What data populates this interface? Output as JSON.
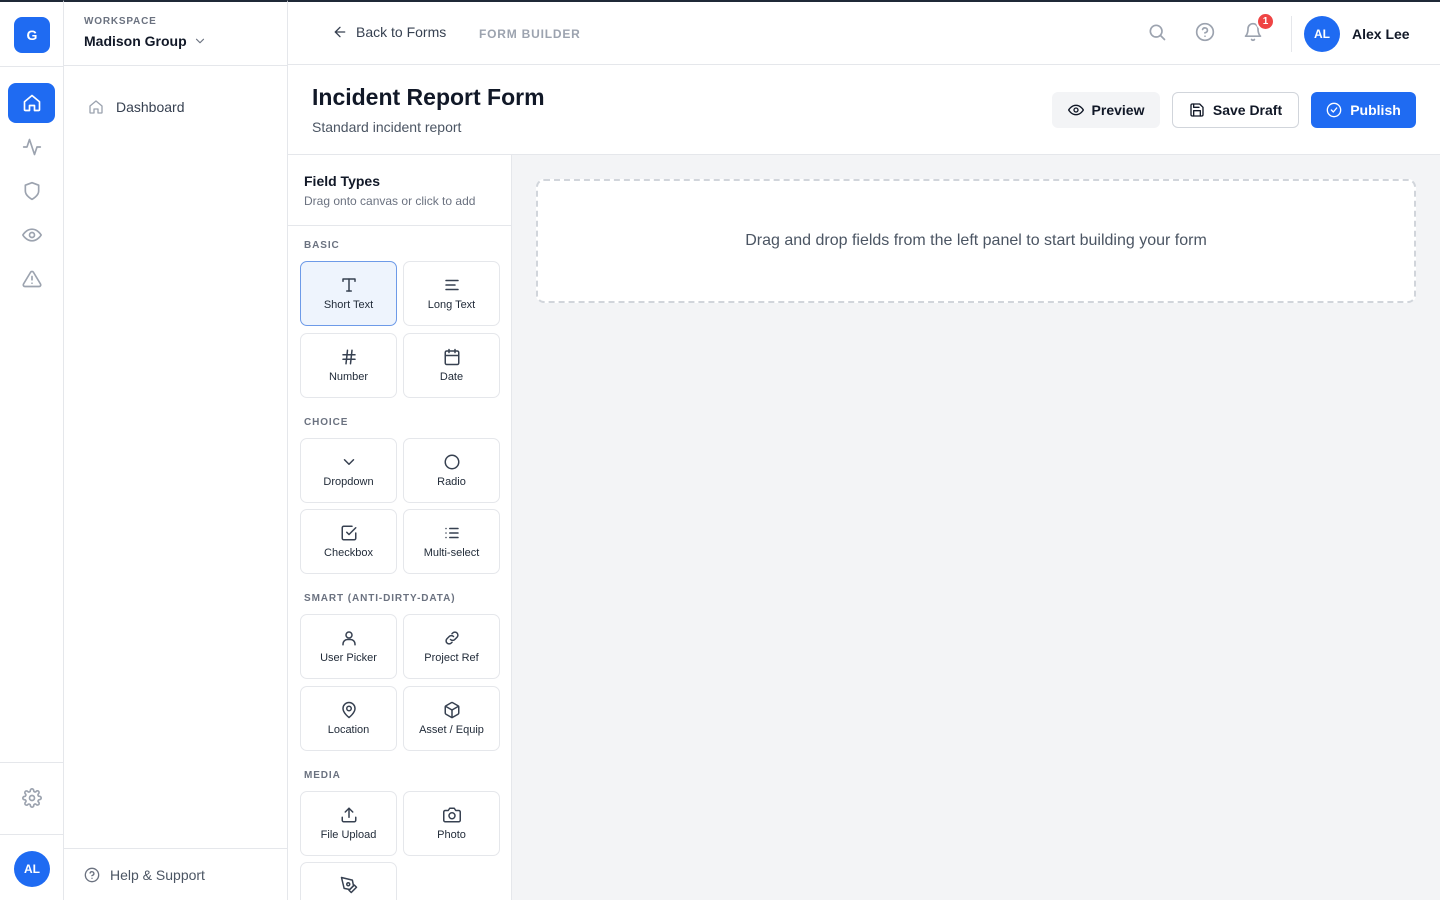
{
  "rail": {
    "logo": "G",
    "nav": [
      "Home",
      "Activity",
      "Security",
      "Monitoring",
      "Alerts"
    ],
    "avatar": "AL"
  },
  "workspace": {
    "label": "WORKSPACE",
    "name": "Madison Group",
    "nav_item": "Dashboard",
    "help": "Help & Support"
  },
  "header": {
    "back": "Back to Forms",
    "breadcrumb": "FORM BUILDER",
    "notification_count": "1",
    "user_initials": "AL",
    "user_name": "Alex Lee"
  },
  "form": {
    "title": "Incident Report Form",
    "description": "Standard incident report",
    "preview_label": "Preview",
    "save_label": "Save Draft",
    "publish_label": "Publish"
  },
  "palette": {
    "title": "Field Types",
    "subtitle": "Drag onto canvas or click to add",
    "groups": [
      {
        "label": "BASIC",
        "items": [
          "Short Text",
          "Long Text",
          "Number",
          "Date"
        ]
      },
      {
        "label": "CHOICE",
        "items": [
          "Dropdown",
          "Radio",
          "Checkbox",
          "Multi-select"
        ]
      },
      {
        "label": "SMART (ANTI-DIRTY-DATA)",
        "items": [
          "User Picker",
          "Project Ref",
          "Location",
          "Asset / Equip"
        ]
      },
      {
        "label": "MEDIA",
        "items": [
          "File Upload",
          "Photo"
        ]
      }
    ],
    "selected": "Short Text"
  },
  "canvas": {
    "empty_message": "Drag and drop fields from the left panel to start building your form"
  },
  "colors": {
    "accent": "#1f6bf2",
    "badge": "#ef4444",
    "canvas_bg": "#f3f4f6"
  }
}
